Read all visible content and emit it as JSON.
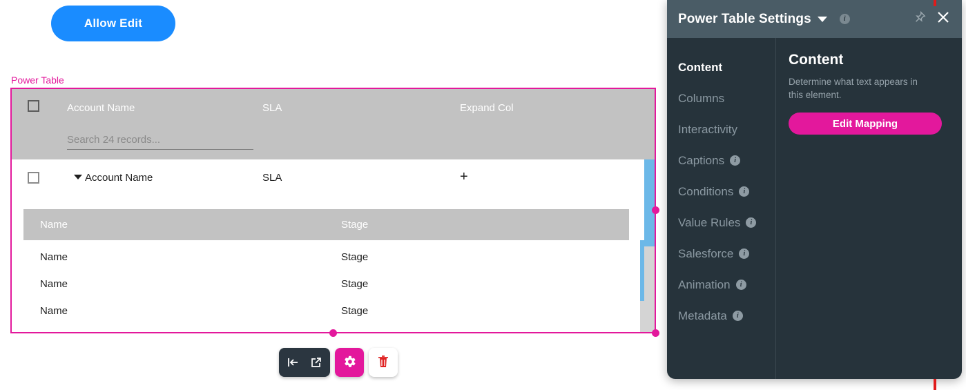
{
  "canvas": {
    "allow_edit_button": "Allow Edit",
    "selection_label": "Power Table"
  },
  "power_table": {
    "columns": [
      "Account Name",
      "SLA",
      "Expand Col"
    ],
    "search_placeholder": "Search 24 records...",
    "search_value": "",
    "row": {
      "account_name": "Account Name",
      "sla": "SLA",
      "expand": "+"
    }
  },
  "inner_table": {
    "columns": [
      "Name",
      "Stage"
    ],
    "rows": [
      {
        "name": "Name",
        "stage": "Stage"
      },
      {
        "name": "Name",
        "stage": "Stage"
      },
      {
        "name": "Name",
        "stage": "Stage"
      }
    ]
  },
  "toolbar": {
    "collapse_icon": "collapse-left-icon",
    "open_icon": "external-link-icon",
    "settings_icon": "gear-icon",
    "delete_icon": "trash-icon"
  },
  "settings_panel": {
    "title": "Power Table Settings",
    "header_info_icon": "info-icon",
    "dropdown_icon": "chevron-down-icon",
    "pin_icon": "pin-icon",
    "close_icon": "close-icon",
    "nav": [
      {
        "label": "Content",
        "active": true,
        "info": false
      },
      {
        "label": "Columns",
        "active": false,
        "info": false
      },
      {
        "label": "Interactivity",
        "active": false,
        "info": false
      },
      {
        "label": "Captions",
        "active": false,
        "info": true
      },
      {
        "label": "Conditions",
        "active": false,
        "info": true
      },
      {
        "label": "Value Rules",
        "active": false,
        "info": true
      },
      {
        "label": "Salesforce",
        "active": false,
        "info": true
      },
      {
        "label": "Animation",
        "active": false,
        "info": true
      },
      {
        "label": "Metadata",
        "active": false,
        "info": true
      }
    ],
    "content": {
      "title": "Content",
      "description": "Determine what text appears in this element.",
      "edit_mapping_button": "Edit Mapping"
    }
  },
  "colors": {
    "accent_magenta": "#e3189c",
    "primary_blue": "#1a8cff",
    "panel_bg": "#26333b",
    "panel_header": "#4a5c66",
    "table_header": "#c2c2c2",
    "scrollbar_thumb": "#6cb8e8",
    "marker_red": "#e01b1b"
  }
}
